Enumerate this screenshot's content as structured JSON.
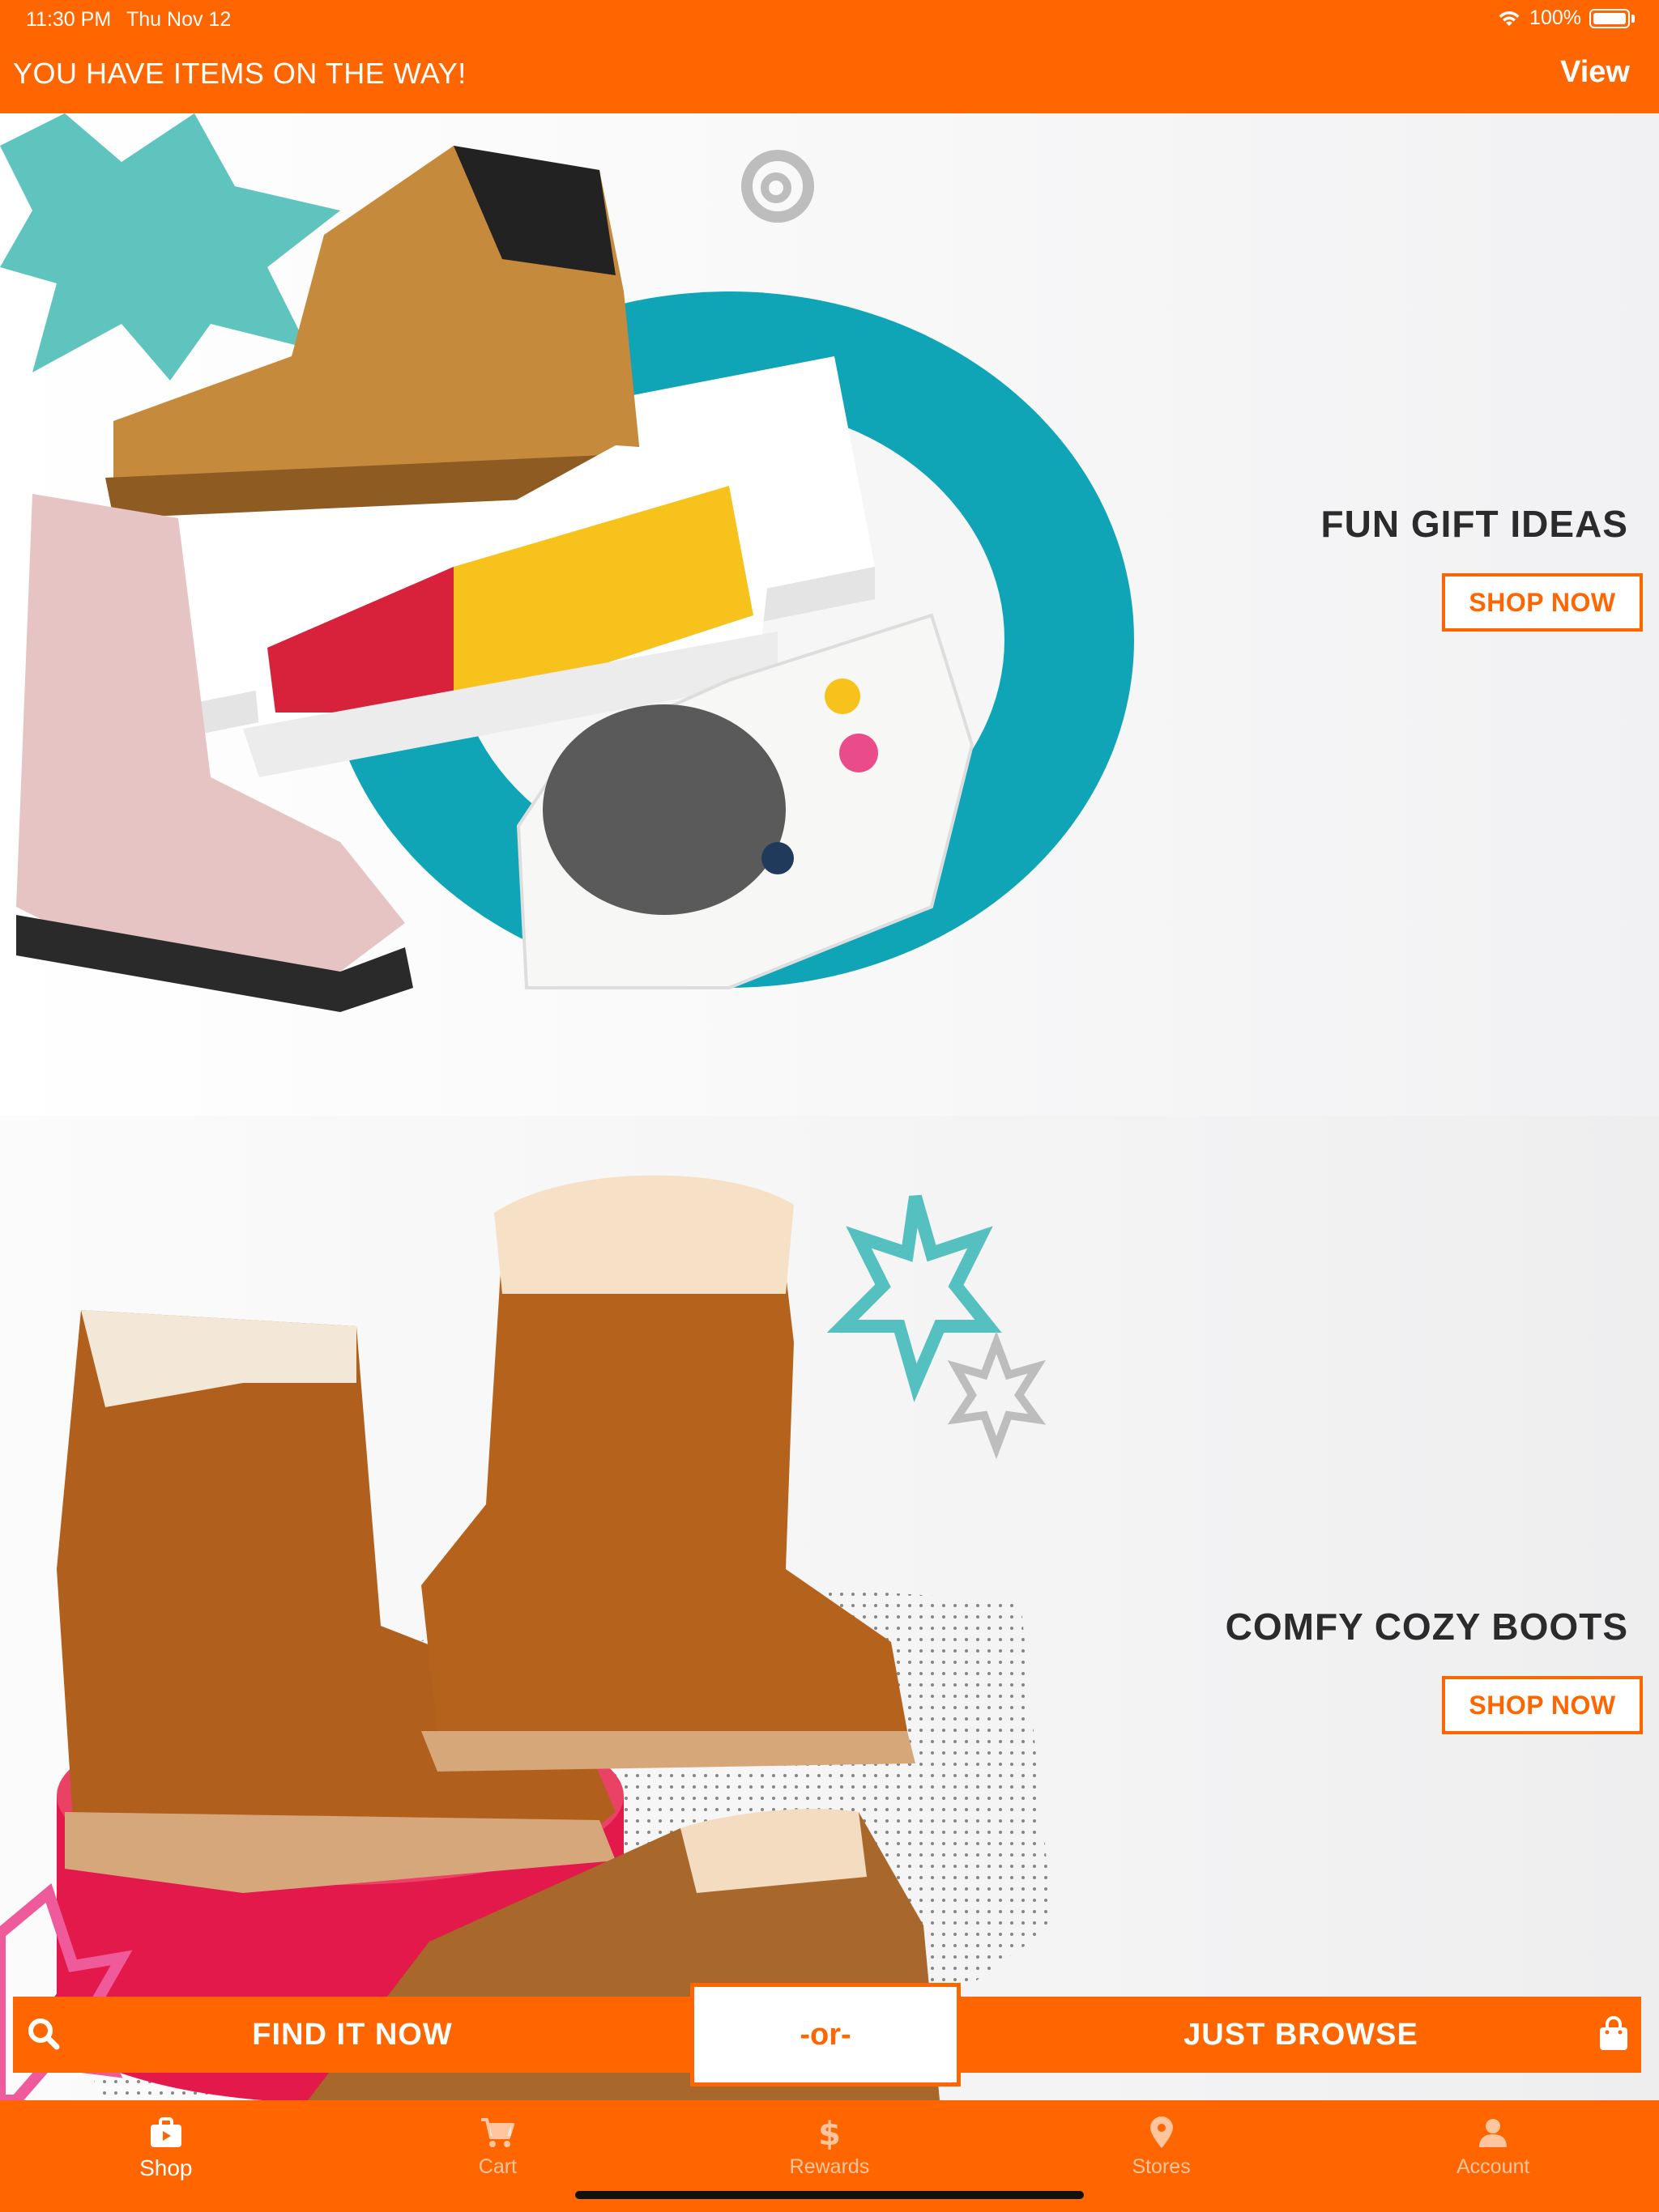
{
  "status_bar": {
    "time": "11:30 PM",
    "date": "Thu Nov 12",
    "battery": "100%",
    "wifi_icon": "wifi-icon"
  },
  "notice": {
    "text": "YOU HAVE ITEMS ON THE WAY!",
    "action": "View"
  },
  "promos": [
    {
      "title": "FUN GIFT IDEAS",
      "button": "SHOP NOW"
    },
    {
      "title": "COMFY COZY BOOTS",
      "button": "SHOP NOW"
    }
  ],
  "actions": {
    "find": "FIND IT NOW",
    "or": "-or-",
    "browse": "JUST BROWSE",
    "find_icon": "search-icon",
    "browse_icon": "shopping-bag-icon"
  },
  "tabs": [
    {
      "label": "Shop",
      "icon": "shop-bag-icon",
      "active": true
    },
    {
      "label": "Cart",
      "icon": "cart-icon",
      "active": false
    },
    {
      "label": "Rewards",
      "icon": "dollar-icon",
      "active": false
    },
    {
      "label": "Stores",
      "icon": "location-pin-icon",
      "active": false
    },
    {
      "label": "Account",
      "icon": "person-icon",
      "active": false
    }
  ],
  "colors": {
    "brand": "#ff6600",
    "text_dark": "#2b2b2b",
    "teal": "#16a7b8",
    "red": "#e4194b"
  }
}
